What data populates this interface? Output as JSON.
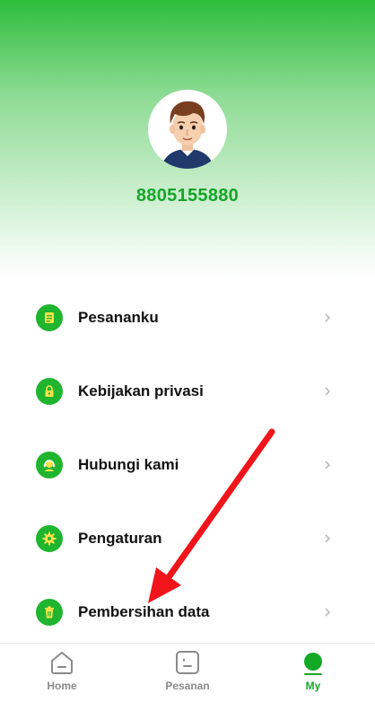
{
  "profile": {
    "phone": "8805155880"
  },
  "menu": {
    "items": [
      {
        "label": "Pesananku",
        "icon": "orders-list-icon"
      },
      {
        "label": "Kebijakan privasi",
        "icon": "privacy-lock-icon"
      },
      {
        "label": "Hubungi kami",
        "icon": "customer-service-icon"
      },
      {
        "label": "Pengaturan",
        "icon": "settings-gear-icon"
      },
      {
        "label": "Pembersihan data",
        "icon": "trash-icon"
      }
    ]
  },
  "bottom_nav": {
    "items": [
      {
        "label": "Home",
        "icon": "home-icon",
        "active": false
      },
      {
        "label": "Pesanan",
        "icon": "orders-icon",
        "active": false
      },
      {
        "label": "My",
        "icon": "profile-dot-icon",
        "active": true
      }
    ]
  },
  "colors": {
    "brand_green": "#1fb52f",
    "phone_text": "#16a52a",
    "annotation_red": "#f0151b",
    "inactive_nav": "#8a8a8a"
  }
}
